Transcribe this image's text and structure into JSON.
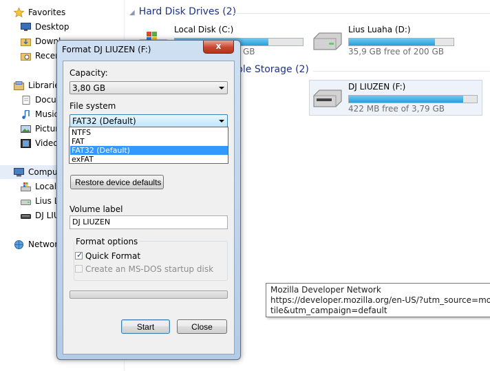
{
  "nav": {
    "favorites": "Favorites",
    "desktop": "Desktop",
    "downloads": "Downl",
    "recent": "Recen",
    "libraries": "Libraries",
    "documents": "Docum",
    "music": "Music",
    "pictures": "Pictur",
    "videos": "Videos",
    "computer": "Compu",
    "local": "Local",
    "lius": "Lius L",
    "dj": "DJ LIU",
    "network": "Network"
  },
  "content": {
    "hdd_header": "Hard Disk Drives (2)",
    "removable_header": "ble Storage (2)",
    "drives": [
      {
        "name": "Local Disk (C:)",
        "free": "GB",
        "used_fraction": 0.73
      },
      {
        "name": "Lius Luaha (D:)",
        "free": "35,9 GB free of 200 GB",
        "used_fraction": 0.82
      },
      {
        "name": "DJ LIUZEN (F:)",
        "free": "422 MB free of 3,79 GB",
        "used_fraction": 0.89
      }
    ]
  },
  "tooltip": {
    "line1": "Mozilla Developer Network",
    "line2": "https://developer.mozilla.org/en-US/?utm_source=mozilla&",
    "line3": "tile&utm_campaign=default"
  },
  "dialog": {
    "title": "Format DJ LIUZEN (F:)",
    "close": "x",
    "capacity_label": "Capacity:",
    "capacity_value": "3,80 GB",
    "filesystem_label": "File system",
    "filesystem_value": "FAT32 (Default)",
    "filesystem_options": [
      "NTFS",
      "FAT",
      "FAT32 (Default)",
      "exFAT"
    ],
    "restore_button": "Restore device defaults",
    "volume_label": "Volume label",
    "volume_value": "DJ LIUZEN",
    "format_options": "Format options",
    "quick_format": "Quick Format",
    "quick_format_checked": true,
    "msdos_disk": "Create an MS-DOS startup disk",
    "msdos_checked": false,
    "progress": 0,
    "start_button": "Start",
    "close_button": "Close"
  }
}
